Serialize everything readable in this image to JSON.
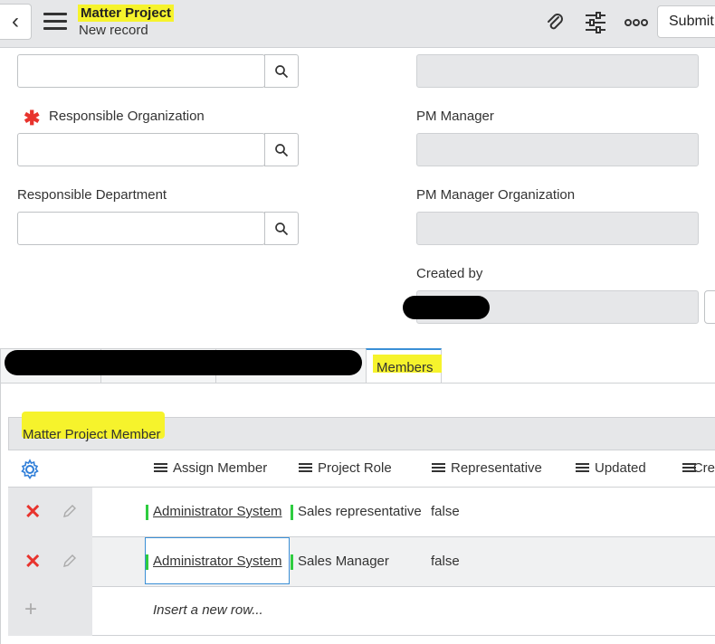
{
  "header": {
    "title": "Matter Project",
    "subtitle": "New record",
    "submit_label": "Submit"
  },
  "form": {
    "responsible_org_label": "Responsible Organization",
    "responsible_dept_label": "Responsible Department",
    "pm_manager_label": "PM Manager",
    "pm_manager_org_label": "PM Manager Organization",
    "created_by_label": "Created by"
  },
  "tabs": {
    "members_label": "Members"
  },
  "related_list": {
    "title": "Matter Project Member",
    "columns": [
      "Assign Member",
      "Project Role",
      "Representative",
      "Updated",
      "Cre"
    ],
    "rows": [
      {
        "member": "Administrator System",
        "role": "Sales representative",
        "representative": "false"
      },
      {
        "member": "Administrator System",
        "role": "Sales Manager",
        "representative": "false"
      }
    ],
    "insert_placeholder": "Insert a new row..."
  },
  "colors": {
    "highlight": "#f6f32c",
    "required": "#e8332d",
    "accent": "#3a8fd6",
    "status_bar": "#2ecc40"
  }
}
